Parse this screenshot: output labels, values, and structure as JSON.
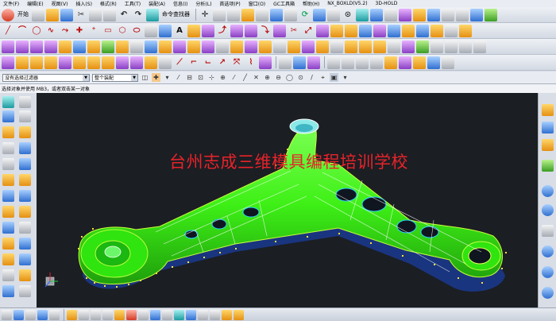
{
  "menu": [
    "文件(F)",
    "编辑(E)",
    "视图(V)",
    "插入(S)",
    "格式(R)",
    "工具(T)",
    "装配(A)",
    "信息(I)",
    "分析(L)",
    "首选项(P)",
    "窗口(O)",
    "GC工具箱",
    "帮助(H)",
    "NX_BOXLD(V5.2)",
    "3D-HOLD"
  ],
  "toolbar": {
    "start_label": "开始",
    "command_finder_label": "命令查找器"
  },
  "selection": {
    "filter_value": "没有选择过滤器",
    "scope_value": "整个装配"
  },
  "cue": "选择对象并使用 MB3，或者双击某一对象",
  "watermark": "台州志成三维模具编程培训学校",
  "colors": {
    "viewport_bg": "#1b1e23",
    "part_green": "#3ef016",
    "watermark_red": "#e8232a"
  }
}
